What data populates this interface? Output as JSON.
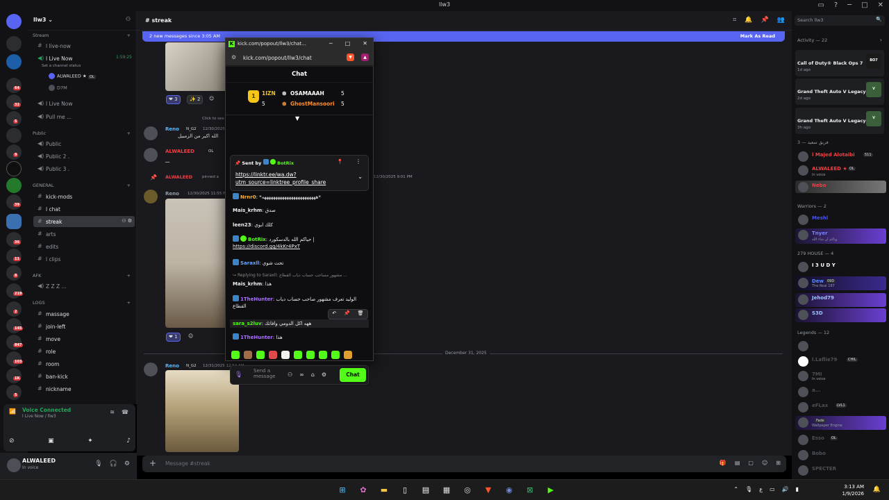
{
  "window": {
    "title": "llw3"
  },
  "server": {
    "name": "llw3"
  },
  "sidebar": {
    "categories": {
      "stream": "Stream",
      "public": "Public",
      "general": "GENERAL",
      "afk": "AFK",
      "logs": "LOGS"
    },
    "stream_items": [
      "l live-now",
      "l Live Now",
      "Set a channel status",
      "ALWALEED ★",
      "D7M",
      "l Live Now",
      "Pull me ..."
    ],
    "stream_voice_time": "1:59:25",
    "stream_voice_user_tag": "OL",
    "public_items": [
      "Public",
      "Public 2 .",
      "Public 3 ."
    ],
    "general_items": [
      "kick-mods",
      "l chat",
      "streak",
      "arts",
      "edits",
      "l clips"
    ],
    "afk_items": [
      "Z Z Z ..."
    ],
    "logs_items": [
      "massage",
      "join-left",
      "move",
      "role",
      "room",
      "ban-kick",
      "nickname"
    ]
  },
  "voice_panel": {
    "status": "Voice Connected",
    "channel": "l Live Now / llw3"
  },
  "user_panel": {
    "name": "ALWALEED",
    "status": "In voice"
  },
  "chat": {
    "channel": "streak",
    "new_messages": "2 new messages since 3:05 AM",
    "mark_as_read": "Mark As Read",
    "messages": [
      {
        "user": "Reno",
        "tag": "N_G2",
        "time": "12/30/2025",
        "text": "الله اكبر من الزمبيل"
      },
      {
        "user": "ALWALEED",
        "tag": "OL",
        "time": "",
        "text": "ـــ"
      },
      {
        "user": "ALWALEED",
        "action": "pinned a",
        "time": ""
      },
      {
        "user": "Reno",
        "time": "12/30/2025 11:55 PM",
        "text": ""
      }
    ],
    "reply_hint": "Click to see",
    "reactions_1": [
      "3",
      "2"
    ],
    "reactions_2": [
      "1"
    ],
    "timestamp_mid": "12/30/2025 9:01 PM",
    "date_divider": "December 31, 2025",
    "last_msg": {
      "user": "Reno",
      "tag": "N_G2",
      "time": "12/31/2025 12:54 AM"
    },
    "composer_placeholder": "Message #streak"
  },
  "members": {
    "search_placeholder": "Search llw3",
    "activity_header": "Activity — 22",
    "activities": [
      {
        "game": "Call of Duty® Black Ops 7",
        "time": "1d ago",
        "art": "BO7"
      },
      {
        "game": "Grand Theft Auto V Legacy",
        "time": "2d ago",
        "art": "V"
      },
      {
        "game": "Grand Theft Auto V Legacy",
        "time": "3h ago",
        "art": "V"
      }
    ],
    "group1_header": "فريق سعيد — 3",
    "group1": [
      {
        "name": "l Majed Alotaibi",
        "tag": "511",
        "sub": "",
        "color": "#f23f43"
      },
      {
        "name": "ALWALEED ★",
        "tag": "OL",
        "sub": "In voice",
        "color": "#f23f43"
      },
      {
        "name": "Nebo",
        "tag": "",
        "sub": "",
        "color": "#f23f43"
      }
    ],
    "group2_header": "Warriors — 2",
    "group2": [
      {
        "name": "Meshl",
        "tag": "",
        "sub": "",
        "color": "#4752f5"
      },
      {
        "name": "Tnyer",
        "tag": "",
        "sub": "وياكم ان شاء الله",
        "color": "#4752f5"
      }
    ],
    "group3_header": "279 HOUSE — 4",
    "group3": [
      {
        "name": "I 3 U D Y",
        "tag": "",
        "sub": "",
        "color": "#ffffff"
      },
      {
        "name": "Dew",
        "tag": "09D",
        "sub": "The Real 187",
        "color": "#5b8cff"
      },
      {
        "name": "Jehod79",
        "tag": "",
        "sub": "",
        "color": "#5b8cff"
      },
      {
        "name": "S3D",
        "tag": "",
        "sub": "",
        "color": "#5b8cff"
      }
    ],
    "group4_header": "Legends — 12",
    "group4": [
      {
        "name": "",
        "tag": "",
        "sub": ""
      },
      {
        "name": "l.Laflie79",
        "tag": "CHIL",
        "sub": ""
      },
      {
        "name": "7MI",
        "tag": "",
        "sub": "In voice"
      },
      {
        "name": "a...",
        "tag": "",
        "sub": ""
      },
      {
        "name": "eFLax",
        "tag": "LVL1",
        "sub": ""
      },
      {
        "name": "",
        "tag": "Fade",
        "sub": "Wallpaper Engine"
      },
      {
        "name": "Esso",
        "tag": "OL",
        "sub": ""
      },
      {
        "name": "Bobo",
        "tag": "",
        "sub": ""
      },
      {
        "name": "SPECTER",
        "tag": "",
        "sub": ""
      }
    ]
  },
  "kick": {
    "window_title": "kick.com/popout/llw3/chat...",
    "url": "kick.com/popout/llw3/chat",
    "header": "Chat",
    "leaderboard": {
      "top_name": "1IZN",
      "top_count": "5",
      "second_name": "OSAMAAAH",
      "second_count": "5",
      "third_name": "GhostMansoori",
      "third_count": "5",
      "rank": "1"
    },
    "pinned": {
      "sent_by_label": "Sent by",
      "sender": "BotRix",
      "link": "https://linktr.ee/wa.dw?utm_source=linktree_profile_share"
    },
    "messages": [
      {
        "user": "Nrnr0",
        "color": "#ffb02e",
        "text": "*ههههههههههههههههههههههههه*"
      },
      {
        "user": "Mais_krhm",
        "color": "#efeff1",
        "text": "صدق"
      },
      {
        "user": "leen23",
        "color": "#efeff1",
        "text": "كلك ابوي"
      },
      {
        "user": "BotRix",
        "color": "#53fc18",
        "text": "حياكم الله بالدسكورد |",
        "link": "https://discord.gg/4kKr4PxT"
      },
      {
        "user": "Saraxll",
        "color": "#3c84c6",
        "text": "تحت شوي"
      },
      {
        "reply": "Replying to Saraxll: مشهور مساحب حساب دياب القطاع ..."
      },
      {
        "user": "Mais_krhm",
        "color": "#efeff1",
        "text": "هذا"
      },
      {
        "user": "1TheHunter",
        "color": "#a970ff",
        "text": "الوليد تعرف مشهور صاحب حساب دياب القطاع"
      },
      {
        "user": "sara_s2luv",
        "color": "#53fc18",
        "text": "ههه اكل الدومي وافاتك"
      },
      {
        "user": "1TheHunter",
        "color": "#a970ff",
        "text": "هذا"
      }
    ],
    "input_placeholder": "Send a message",
    "send_label": "Chat"
  },
  "taskbar": {
    "time": "3:13 AM",
    "date": "1/9/2026",
    "lang": "ع"
  },
  "colors": {
    "accent": "#5865f2",
    "kick_green": "#53fc18",
    "online": "#23a559"
  }
}
